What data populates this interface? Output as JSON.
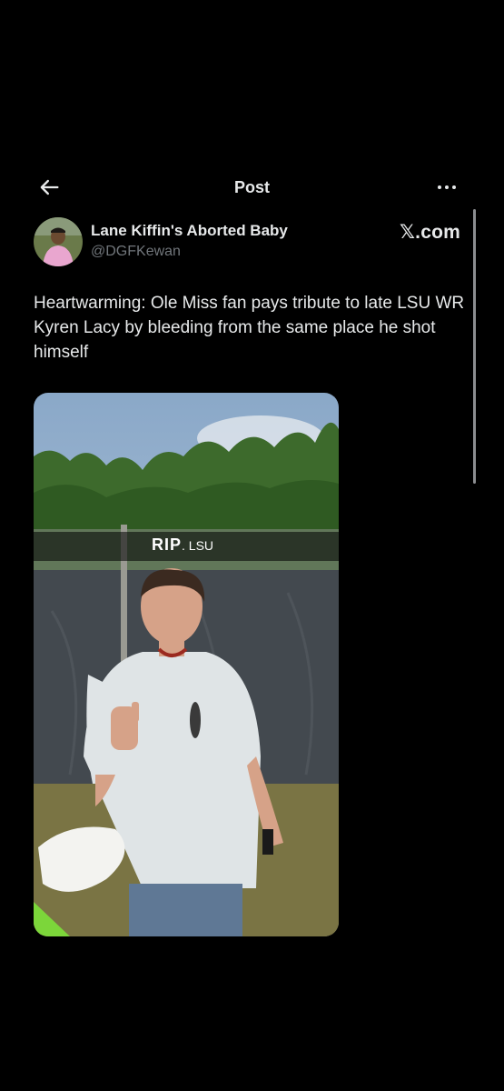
{
  "header": {
    "title": "Post",
    "back_icon": "arrow-left-icon",
    "more_icon": "more-horizontal-icon"
  },
  "author": {
    "display_name": "Lane Kiffin's Aborted Baby",
    "handle": "@DGFKewan"
  },
  "watermark": {
    "x_glyph": "𝕏",
    "suffix": ".com"
  },
  "post": {
    "text": "Heartwarming: Ole Miss fan pays tribute to late LSU WR Kyren Lacy by bleeding from the same place he shot himself"
  },
  "photo": {
    "caption_prefix": "RIP",
    "caption_suffix": ". LSU"
  },
  "colors": {
    "background": "#000000",
    "text": "#e7e9ea",
    "secondary": "#71767b"
  }
}
